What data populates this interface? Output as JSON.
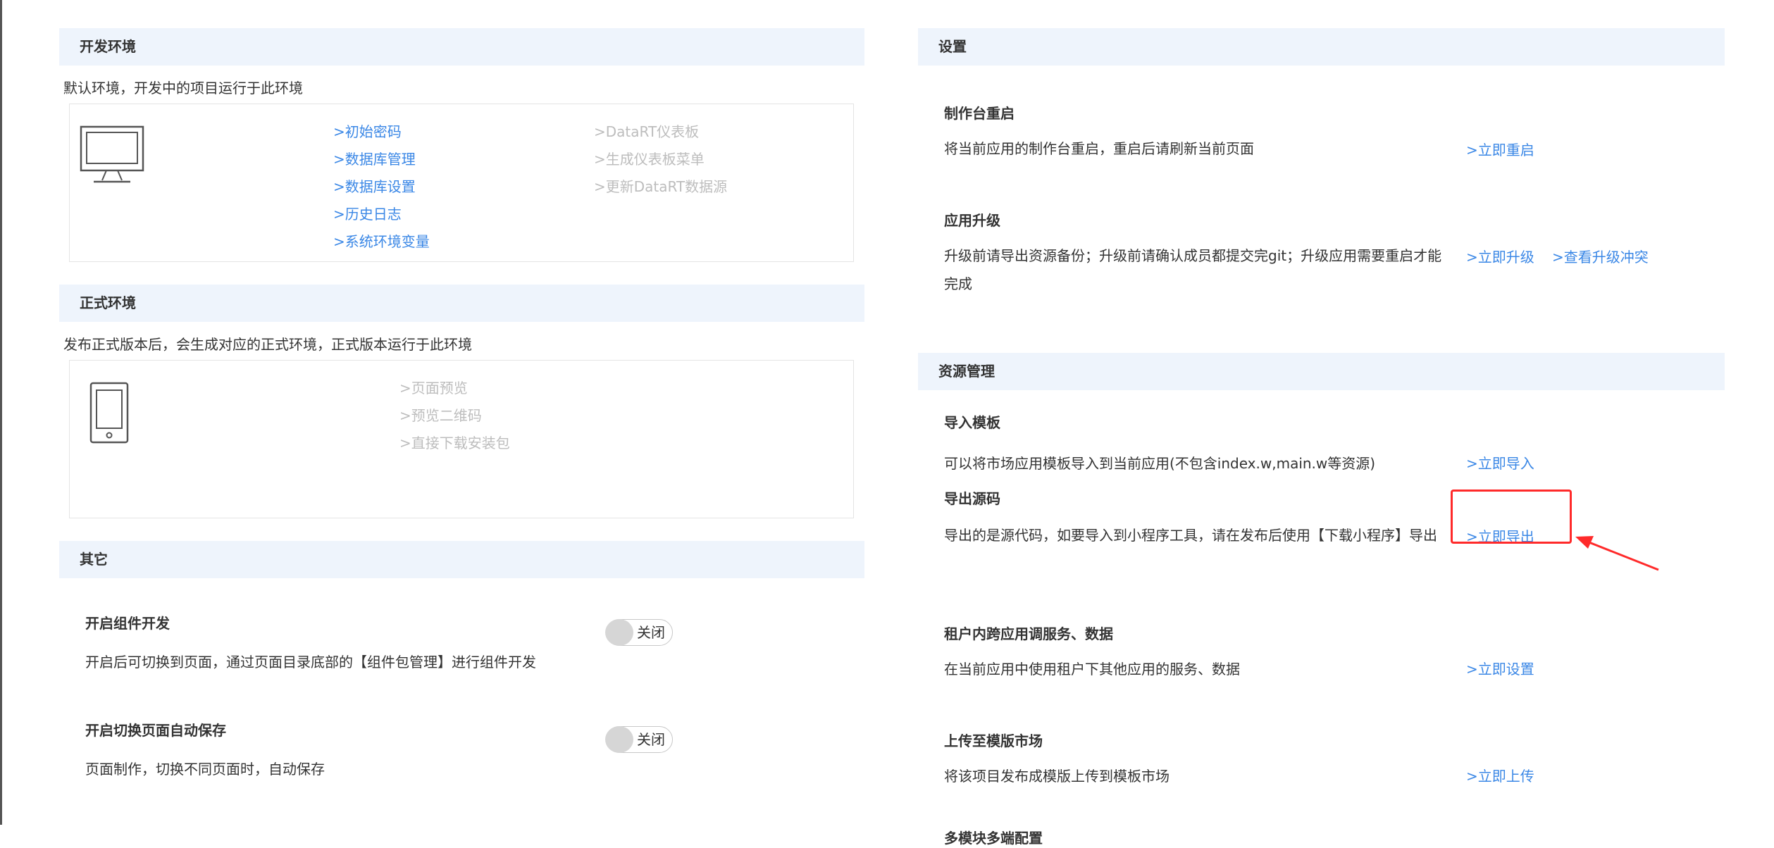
{
  "dev_env": {
    "title": "开发环境",
    "description": "默认环境，开发中的项目运行于此环境",
    "links_active": [
      ">初始密码",
      ">数据库管理",
      ">数据库设置",
      ">历史日志",
      ">系统环境变量"
    ],
    "links_disabled": [
      ">DataRT仪表板",
      ">生成仪表板菜单",
      ">更新DataRT数据源"
    ]
  },
  "prod_env": {
    "title": "正式环境",
    "description": "发布正式版本后，会生成对应的正式环境，正式版本运行于此环境",
    "links_disabled": [
      ">页面预览",
      ">预览二维码",
      ">直接下载安装包"
    ]
  },
  "other": {
    "title": "其它",
    "items": [
      {
        "title": "开启组件开发",
        "desc": "开启后可切换到页面，通过页面目录底部的【组件包管理】进行组件开发",
        "toggle": "关闭"
      },
      {
        "title": "开启切换页面自动保存",
        "desc": "页面制作，切换不同页面时，自动保存",
        "toggle": "关闭"
      }
    ]
  },
  "settings": {
    "title": "设置",
    "items": [
      {
        "title": "制作台重启",
        "desc": "将当前应用的制作台重启，重启后请刷新当前页面",
        "actions": [
          ">立即重启"
        ]
      },
      {
        "title": "应用升级",
        "desc": "升级前请导出资源备份；升级前请确认成员都提交完git；升级应用需要重启才能完成",
        "actions": [
          ">立即升级",
          ">查看升级冲突"
        ]
      }
    ]
  },
  "resources": {
    "title": "资源管理",
    "items": [
      {
        "title": "导入模板",
        "desc": "可以将市场应用模板导入到当前应用(不包含index.w,main.w等资源)",
        "actions": [
          ">立即导入"
        ]
      },
      {
        "title": "导出源码",
        "desc": "导出的是源代码，如要导入到小程序工具，请在发布后使用【下载小程序】导出",
        "actions": [
          ">立即导出"
        ]
      },
      {
        "title": "租户内跨应用调服务、数据",
        "desc": "在当前应用中使用租户下其他应用的服务、数据",
        "actions": [
          ">立即设置"
        ]
      },
      {
        "title": "上传至模版市场",
        "desc": "将该项目发布成模版上传到模板市场",
        "actions": [
          ">立即上传"
        ]
      },
      {
        "title": "多模块多端配置"
      }
    ]
  },
  "colors": {
    "link": "#3a87e6",
    "link_disabled": "#bdbdbd",
    "header_bg": "#eef4fc",
    "highlight": "#ff2a2a"
  },
  "icons": [
    "monitor-icon",
    "phone-icon",
    "red-arrow-icon"
  ]
}
